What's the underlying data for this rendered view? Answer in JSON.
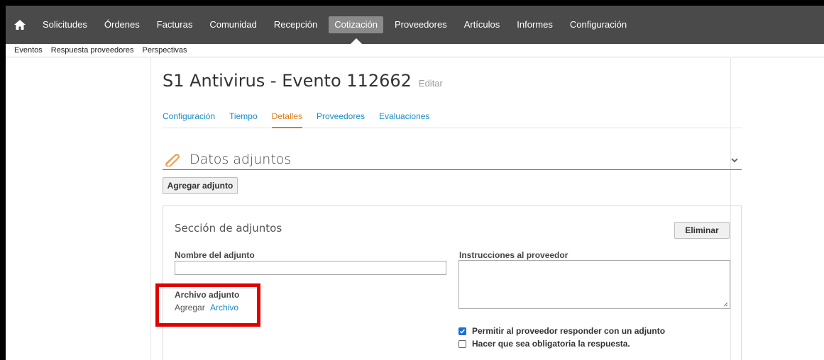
{
  "nav": {
    "items": [
      "Solicitudes",
      "Órdenes",
      "Facturas",
      "Comunidad",
      "Recepción",
      "Cotización",
      "Proveedores",
      "Artículos",
      "Informes",
      "Configuración"
    ],
    "active_index": 5,
    "home_icon": "home-icon"
  },
  "subnav": {
    "items": [
      "Eventos",
      "Respuesta proveedores",
      "Perspectivas"
    ]
  },
  "page": {
    "title": "S1 Antivirus - Evento 112662",
    "edit_label": "Editar"
  },
  "tabs": {
    "items": [
      "Configuración",
      "Tiempo",
      "Detalles",
      "Proveedores",
      "Evaluaciones"
    ],
    "active_index": 2
  },
  "attachments": {
    "title": "Datos adjuntos",
    "add_button": "Agregar adjunto",
    "section": {
      "title": "Sección de adjuntos",
      "delete_button": "Eliminar",
      "name_label": "Nombre del adjunto",
      "name_value": "",
      "instructions_label": "Instrucciones al proveedor",
      "instructions_value": "",
      "file_label": "Archivo adjunto",
      "file_add_text": "Agregar",
      "file_link": "Archivo",
      "checkbox_allow": {
        "label": "Permitir al proveedor responder con un adjunto",
        "checked": true
      },
      "checkbox_required": {
        "label": "Hacer que sea obligatoria la respuesta.",
        "checked": false
      }
    }
  },
  "colors": {
    "nav_bg": "#4a4a4a",
    "active_tab": "#e07b1a",
    "link": "#1a8cc7",
    "highlight": "#e00000"
  }
}
